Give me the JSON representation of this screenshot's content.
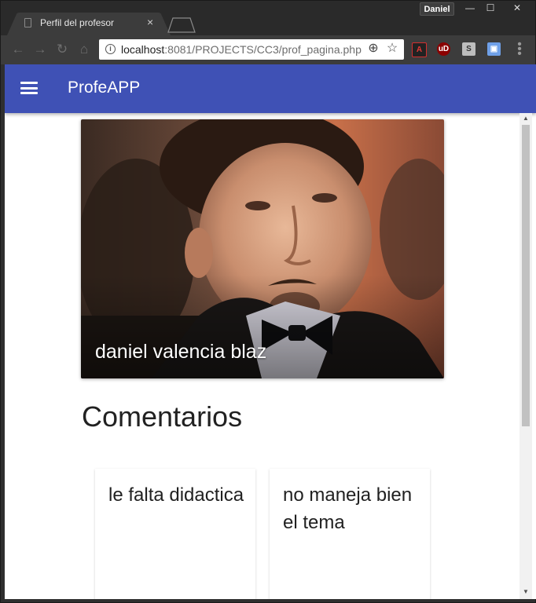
{
  "browser": {
    "tab_title": "Perfil del profesor",
    "tab_close": "×",
    "user_name": "Daniel",
    "window_controls": {
      "minimize": "—",
      "maximize": "☐",
      "close": "✕"
    },
    "url_host": "localhost",
    "url_rest": ":8081/PROJECTS/CC3/prof_pagina.php",
    "nav_icons": {
      "back": "←",
      "forward": "→",
      "reload": "↻",
      "home": "⌂"
    },
    "omnibox_icons": {
      "zoom": "⊕",
      "bookmark": "☆"
    },
    "extensions": [
      {
        "name": "pdf-extension-icon",
        "label": "A",
        "color": "#d32f2f"
      },
      {
        "name": "ublock-extension-icon",
        "label": "uD",
        "color": "#8b0000"
      },
      {
        "name": "s-extension-icon",
        "label": "S",
        "color": "#9e9e9e"
      },
      {
        "name": "screen-extension-icon",
        "label": "▣",
        "color": "#4a7fd6"
      }
    ],
    "menu": "⋮"
  },
  "app": {
    "title": "ProfeAPP",
    "primary_color": "#3f51b5"
  },
  "profile": {
    "name": "daniel valencia blaz"
  },
  "comments": {
    "heading": "Comentarios",
    "items": [
      {
        "text": "le falta didactica"
      },
      {
        "text": "no maneja bien el tema"
      }
    ]
  }
}
